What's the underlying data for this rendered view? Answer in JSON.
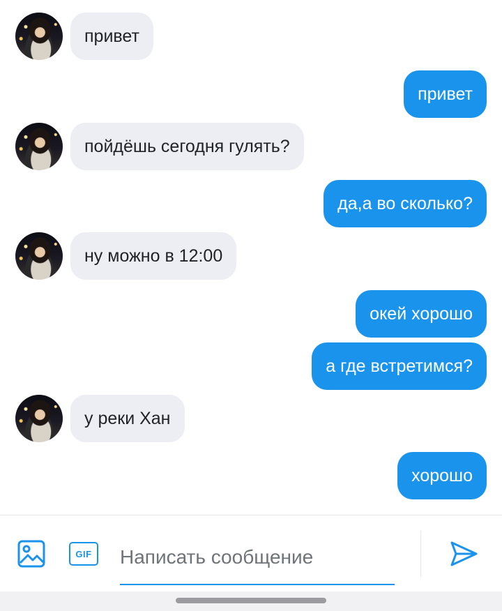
{
  "messages": [
    {
      "from": "them",
      "text": "привет"
    },
    {
      "from": "me",
      "text": "привет"
    },
    {
      "from": "them",
      "text": "пойдёшь сегодня гулять?"
    },
    {
      "from": "me",
      "text": "да,а во сколько?"
    },
    {
      "from": "them",
      "text": "ну можно в 12:00"
    },
    {
      "from": "me",
      "text": "окей хорошо"
    },
    {
      "from": "me",
      "text": "а где встретимся?"
    },
    {
      "from": "them",
      "text": "у реки Хан"
    },
    {
      "from": "me",
      "text": "хорошо"
    }
  ],
  "composer": {
    "placeholder": "Написать сообщение",
    "gif_label": "GIF",
    "image_icon": "image-icon",
    "send_icon": "send-icon"
  },
  "colors": {
    "accent": "#1a93ec",
    "incoming_bubble": "#eceef3",
    "outgoing_text": "#ffffff"
  }
}
